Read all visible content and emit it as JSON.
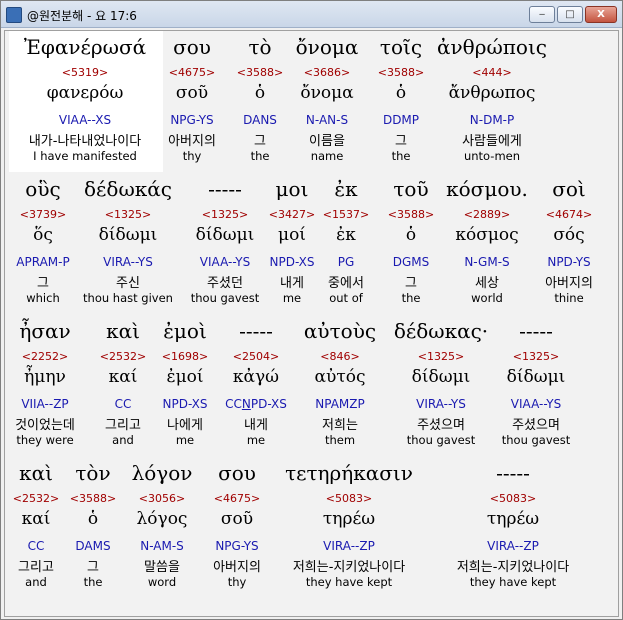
{
  "window": {
    "title": "@원전분해 - 요 17:6",
    "btn_min": "‒",
    "btn_max": "□",
    "btn_close": "X"
  },
  "rows": [
    {
      "words": [
        {
          "g": "Ἐφανέρωσά",
          "n": "<5319>",
          "l": "φανερόω",
          "p": "VIAA--XS",
          "k": "내가-나타내었나이다",
          "e": "I have manifested"
        },
        {
          "g": "σου",
          "n": "<4675>",
          "l": "σοῦ",
          "p": "NPG-YS",
          "k": "아버지의",
          "e": "thy"
        },
        {
          "g": "τὸ",
          "n": "<3588>",
          "l": "ὁ",
          "p": "DANS",
          "k": "그",
          "e": "the"
        },
        {
          "g": "ὄνομα",
          "n": "<3686>",
          "l": "ὄνομα",
          "p": "N-AN-S",
          "k": "이름을",
          "e": "name"
        },
        {
          "g": "τοῖς",
          "n": "<3588>",
          "l": "ὁ",
          "p": "DDMP",
          "k": "그",
          "e": "the"
        },
        {
          "g": "ἀνθρώποις",
          "n": "<444>",
          "l": "ἄνθρωπος",
          "p": "N-DM-P",
          "k": "사람들에게",
          "e": "unto-men"
        }
      ]
    },
    {
      "words": [
        {
          "g": "οὓς",
          "n": "<3739>",
          "l": "ὅς",
          "p": "APRAM-P",
          "k": "그",
          "e": "which"
        },
        {
          "g": "δέδωκάς",
          "n": "<1325>",
          "l": "δίδωμι",
          "p": "VIRA--YS",
          "k": "주신",
          "e": "thou hast given"
        },
        {
          "g": "-----",
          "n": "<1325>",
          "l": "δίδωμι",
          "p": "VIAA--YS",
          "k": "주셨던",
          "e": "thou gavest"
        },
        {
          "g": "μοι",
          "n": "<3427>",
          "l": "μοί",
          "p": "NPD-XS",
          "k": "내게",
          "e": "me"
        },
        {
          "g": "ἐκ",
          "n": "<1537>",
          "l": "ἐκ",
          "p": "PG",
          "k": "중에서",
          "e": "out of"
        },
        {
          "g": "τοῦ",
          "n": "<3588>",
          "l": "ὁ",
          "p": "DGMS",
          "k": "그",
          "e": "the"
        },
        {
          "g": "κόσμου.",
          "n": "<2889>",
          "l": "κόσμος",
          "p": "N-GM-S",
          "k": "세상",
          "e": "world"
        },
        {
          "g": "σοὶ",
          "n": "<4674>",
          "l": "σός",
          "p": "NPD-YS",
          "k": "아버지의",
          "e": "thine"
        }
      ]
    },
    {
      "words": [
        {
          "g": "ἦσαν",
          "n": "<2252>",
          "l": "ἦμην",
          "p": "VIIA--ZP",
          "k": "것이었는데",
          "e": "they were"
        },
        {
          "g": "καὶ",
          "n": "<2532>",
          "l": "καί",
          "p": "CC",
          "k": "그리고",
          "e": "and"
        },
        {
          "g": "ἐμοὶ",
          "n": "<1698>",
          "l": "ἐμοί",
          "p": "NPD-XS",
          "k": "나에게",
          "e": "me"
        },
        {
          "g": "-----",
          "n": "<2504>",
          "l": "κἀγώ",
          "p": "CCNPD-XS",
          "k": "내게",
          "e": "me"
        },
        {
          "g": "αὐτοὺς",
          "n": "<846>",
          "l": "αὐτός",
          "p": "NPAMZP",
          "k": "저희는",
          "e": "them"
        },
        {
          "g": "δέδωκας·",
          "n": "<1325>",
          "l": "δίδωμι",
          "p": "VIRA--YS",
          "k": "주셨으며",
          "e": "thou gavest"
        },
        {
          "g": "-----",
          "n": "<1325>",
          "l": "δίδωμι",
          "p": "VIAA--YS",
          "k": "주셨으며",
          "e": "thou gavest"
        }
      ]
    },
    {
      "words": [
        {
          "g": "καὶ",
          "n": "<2532>",
          "l": "καί",
          "p": "CC",
          "k": "그리고",
          "e": "and"
        },
        {
          "g": "τὸν",
          "n": "<3588>",
          "l": "ὁ",
          "p": "DAMS",
          "k": "그",
          "e": "the"
        },
        {
          "g": "λόγον",
          "n": "<3056>",
          "l": "λόγος",
          "p": "N-AM-S",
          "k": "말씀을",
          "e": "word"
        },
        {
          "g": "σου",
          "n": "<4675>",
          "l": "σοῦ",
          "p": "NPG-YS",
          "k": "아버지의",
          "e": "thy"
        },
        {
          "g": "τετηρήκασιν",
          "n": "<5083>",
          "l": "τηρέω",
          "p": "VIRA--ZP",
          "k": "저희는-지키었나이다",
          "e": "they have kept"
        },
        {
          "g": "-----",
          "n": "<5083>",
          "l": "τηρέω",
          "p": "VIRA--ZP",
          "k": "저희는-지키었나이다",
          "e": "they have kept"
        }
      ]
    }
  ]
}
